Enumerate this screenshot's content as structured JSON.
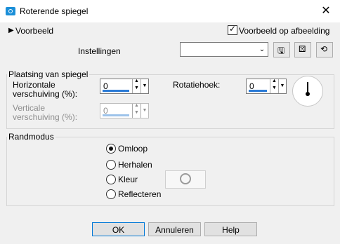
{
  "window": {
    "title": "Roterende spiegel"
  },
  "preview": {
    "toggle_label": "Voorbeeld",
    "checkbox_label": "Voorbeeld op afbeelding",
    "checked": true
  },
  "settings": {
    "label": "Instellingen",
    "value": ""
  },
  "plaatsing": {
    "legend": "Plaatsing van spiegel",
    "horiz_label_1": "Horizontale",
    "horiz_label_2": "verschuiving (%):",
    "horiz_value": "0",
    "vert_label_1": "Verticale",
    "vert_label_2": "verschuiving (%):",
    "vert_value": "0",
    "rot_label": "Rotatiehoek:",
    "rot_value": "0"
  },
  "randmodus": {
    "legend": "Randmodus",
    "options": [
      "Omloop",
      "Herhalen",
      "Kleur",
      "Reflecteren"
    ],
    "selected": "Omloop"
  },
  "buttons": {
    "ok": "OK",
    "cancel": "Annuleren",
    "help": "Help"
  }
}
